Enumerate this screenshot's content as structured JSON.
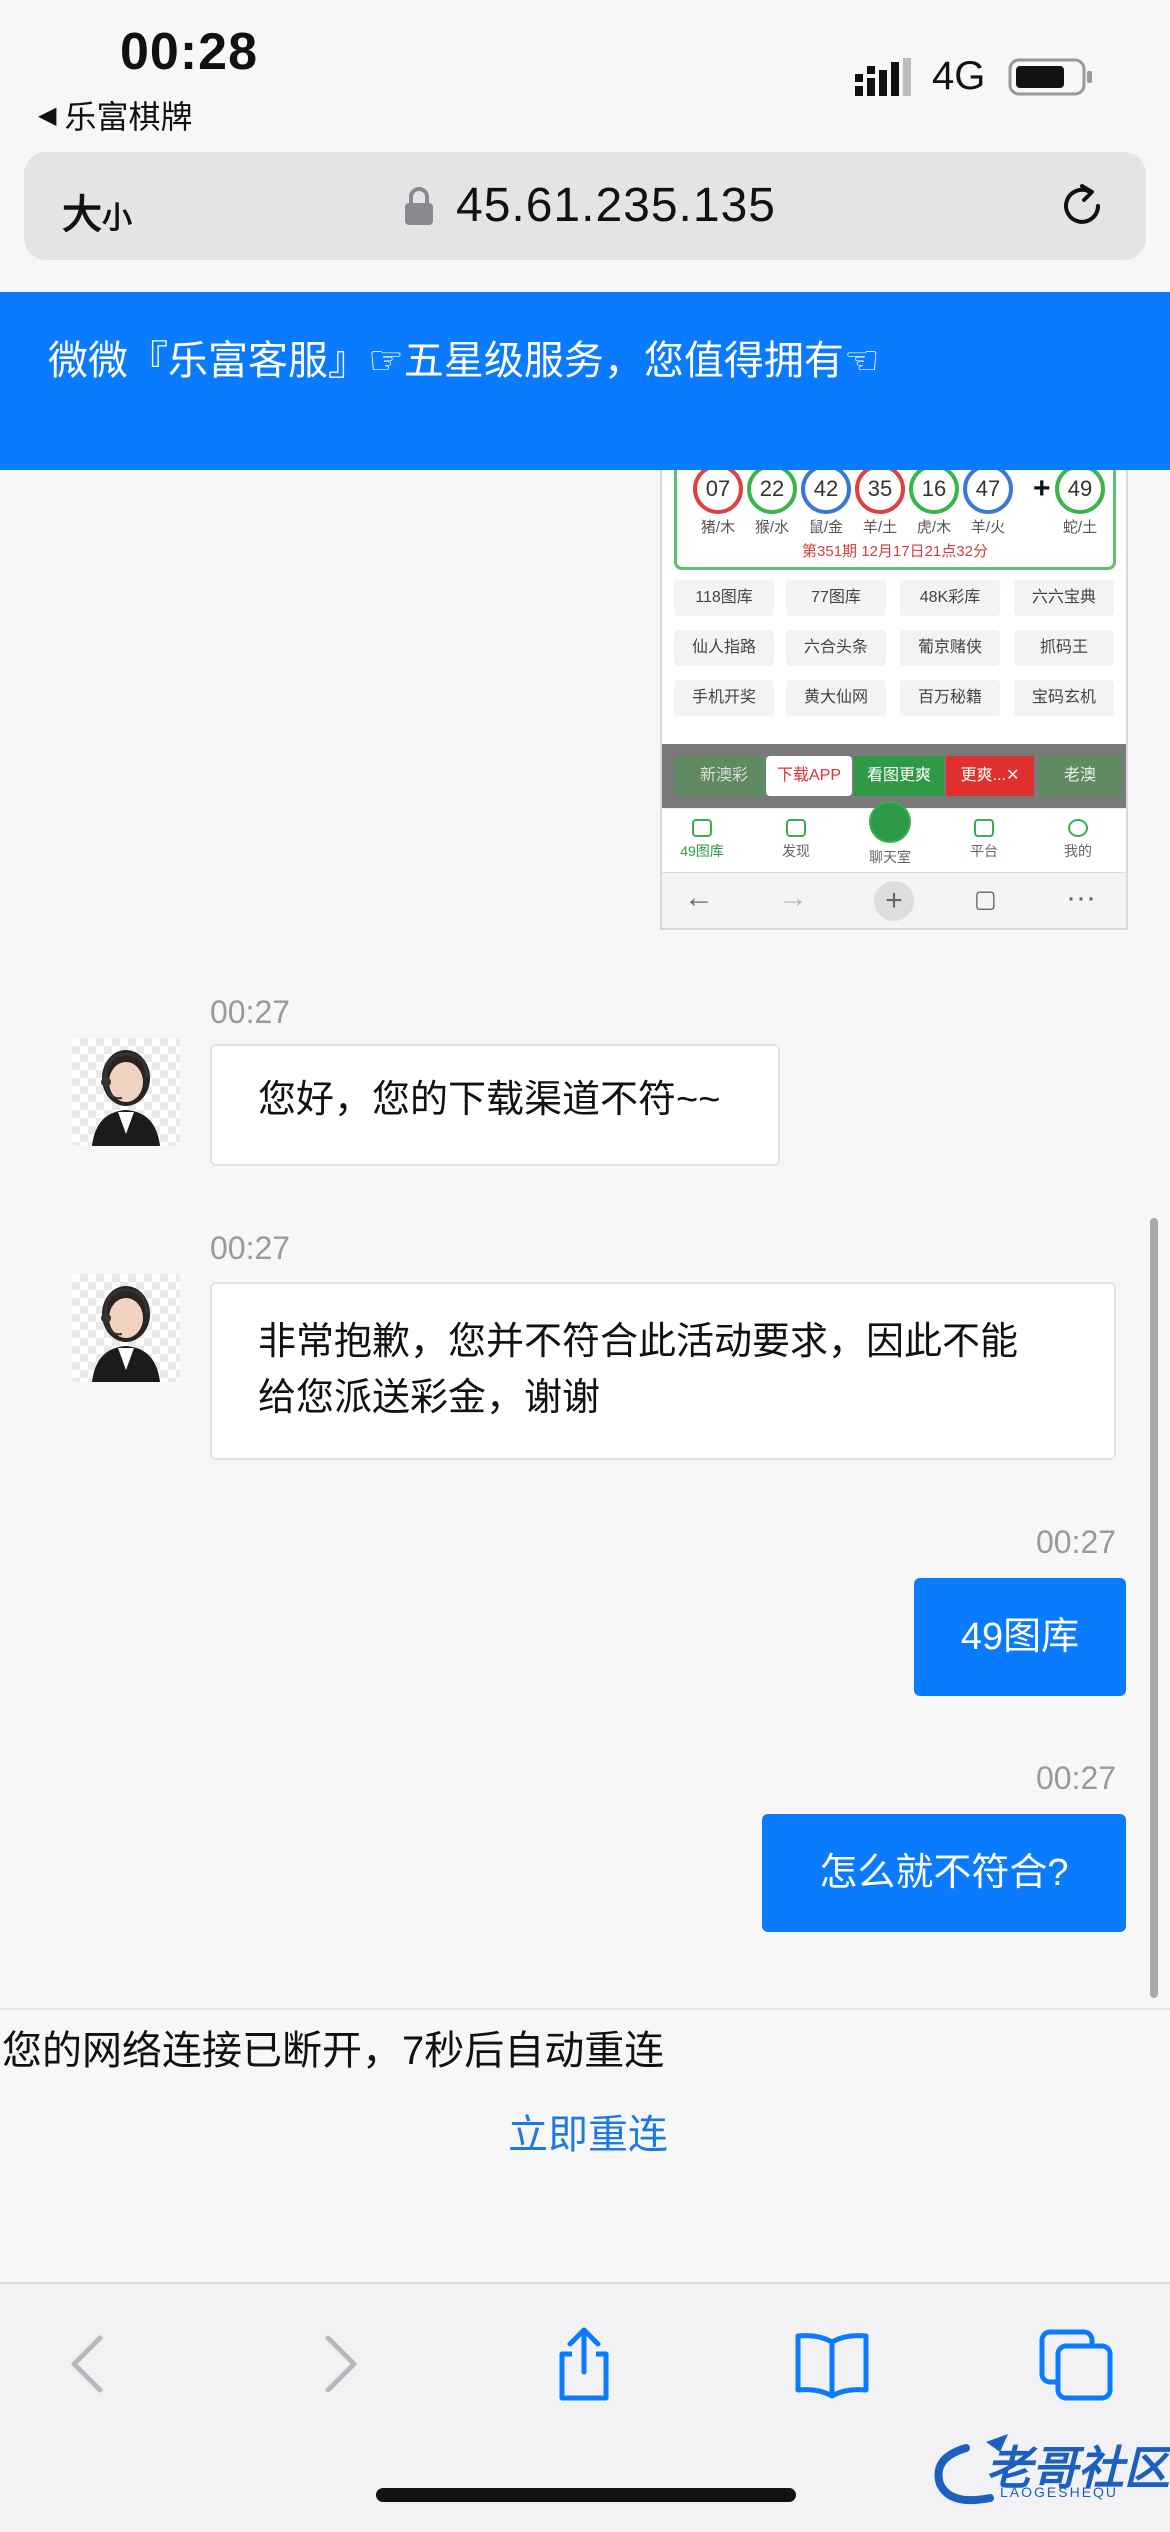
{
  "status_bar": {
    "time": "00:28",
    "back_app": "乐富棋牌",
    "network": "4G"
  },
  "address_bar": {
    "text_size_big": "大",
    "text_size_small": "小",
    "url": "45.61.235.135"
  },
  "banner": {
    "text": "微微『乐富客服』☞五星级服务，您值得拥有☜"
  },
  "embedded_screenshot": {
    "balls": [
      {
        "number": "07",
        "label": "猪/木",
        "color": "red"
      },
      {
        "number": "22",
        "label": "猴/水",
        "color": "green"
      },
      {
        "number": "42",
        "label": "鼠/金",
        "color": "blue"
      },
      {
        "number": "35",
        "label": "羊/土",
        "color": "red"
      },
      {
        "number": "16",
        "label": "虎/木",
        "color": "green"
      },
      {
        "number": "47",
        "label": "羊/火",
        "color": "blue"
      },
      {
        "number": "49",
        "label": "蛇/土",
        "color": "green"
      }
    ],
    "plus": "+",
    "draw_info": "第351期 12月17日21点32分",
    "grid_buttons": [
      "118图库",
      "77图库",
      "48K彩库",
      "六六宝典",
      "仙人指路",
      "六合头条",
      "葡京赌侠",
      "抓码王",
      "手机开奖",
      "黄大仙网",
      "百万秘籍",
      "宝码玄机"
    ],
    "overlay_buttons": [
      "新澳彩",
      "下载APP",
      "看图更爽",
      "更爽...✕",
      "老澳"
    ],
    "tabs": [
      "49图库",
      "发现",
      "聊天室",
      "平台",
      "我的"
    ],
    "nav": [
      "←",
      "→",
      "+",
      "▢",
      "···"
    ]
  },
  "messages": [
    {
      "side": "left",
      "time": "00:27",
      "text": "您好，您的下载渠道不符~~"
    },
    {
      "side": "left",
      "time": "00:27",
      "text_line1": "非常抱歉，您并不符合此活动要求，因此不能",
      "text_line2": "给您派送彩金，谢谢"
    },
    {
      "side": "right",
      "time": "00:27",
      "text": "49图库"
    },
    {
      "side": "right",
      "time": "00:27",
      "text": "怎么就不符合?"
    }
  ],
  "connection_notice": {
    "text": "您的网络连接已断开，7秒后自动重连",
    "reconnect_label": "立即重连"
  },
  "toolbar": {
    "icons": [
      "back-icon",
      "forward-icon",
      "share-icon",
      "bookmarks-icon",
      "tabs-icon"
    ]
  },
  "watermark": {
    "text": "老哥社区",
    "sub": "LAOGESHEQU"
  },
  "colors": {
    "accent_blue": "#0a7bff",
    "link_blue": "#1e7ae0",
    "green": "#39b54a",
    "red": "#e04040"
  }
}
